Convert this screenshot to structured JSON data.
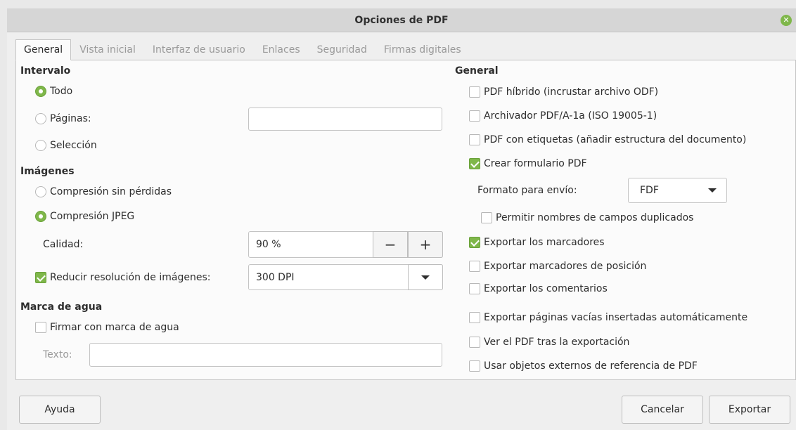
{
  "window": {
    "title": "Opciones de PDF"
  },
  "tabs": [
    {
      "label": "General"
    },
    {
      "label": "Vista inicial"
    },
    {
      "label": "Interfaz de usuario"
    },
    {
      "label": "Enlaces"
    },
    {
      "label": "Seguridad"
    },
    {
      "label": "Firmas digitales"
    }
  ],
  "left": {
    "range": {
      "heading": "Intervalo",
      "all": "Todo",
      "pages": "Páginas:",
      "pages_value": "",
      "selection": "Selección"
    },
    "images": {
      "heading": "Imágenes",
      "lossless": "Compresión sin pérdidas",
      "jpeg": "Compresión JPEG",
      "quality_label": "Calidad:",
      "quality_value": "90 %",
      "minus": "−",
      "plus": "+",
      "reduce_label": "Reducir resolución de imágenes:",
      "reduce_value": "300 DPI"
    },
    "watermark": {
      "heading": "Marca de agua",
      "sign": "Firmar con marca de agua",
      "text_label": "Texto:",
      "text_value": ""
    }
  },
  "right": {
    "heading": "General",
    "hybrid": "PDF híbrido (incrustar archivo ODF)",
    "archive": "Archivador PDF/A-1a (ISO 19005-1)",
    "tagged": "PDF con etiquetas (añadir estructura del documento)",
    "create_form": "Crear formulario PDF",
    "submit_format_label": "Formato para envío:",
    "submit_format_value": "FDF",
    "allow_duplicates": "Permitir nombres de campos duplicados",
    "export_bookmarks": "Exportar los marcadores",
    "export_placeholders": "Exportar marcadores de posición",
    "export_comments": "Exportar los comentarios",
    "export_blank_pages": "Exportar páginas vacías insertadas automáticamente",
    "view_pdf": "Ver el PDF tras la exportación",
    "use_xobjects": "Usar objetos externos de referencia de PDF"
  },
  "buttons": {
    "help": "Ayuda",
    "cancel": "Cancelar",
    "export": "Exportar"
  },
  "colors": {
    "accent": "#7fb74a",
    "titlebar": "#d6d6d6",
    "panel": "#fbfbfb"
  }
}
